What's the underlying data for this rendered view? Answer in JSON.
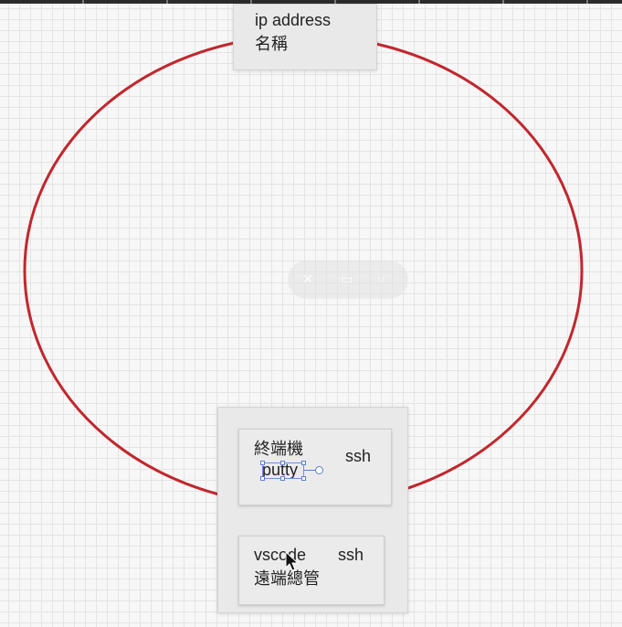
{
  "canvas": {
    "ellipse_color": "#c1272d"
  },
  "top_card": {
    "line1": "ip address",
    "line2": "名稱"
  },
  "terminal_card": {
    "title": "終端機",
    "protocol": "ssh",
    "selected_text": "putty"
  },
  "vscode_card": {
    "title": "vscode",
    "protocol": "ssh",
    "subtitle": "遠端總管"
  },
  "hover_toolbar": {
    "icons": [
      "pin-off-icon",
      "copy-icon",
      "more-icon"
    ]
  }
}
